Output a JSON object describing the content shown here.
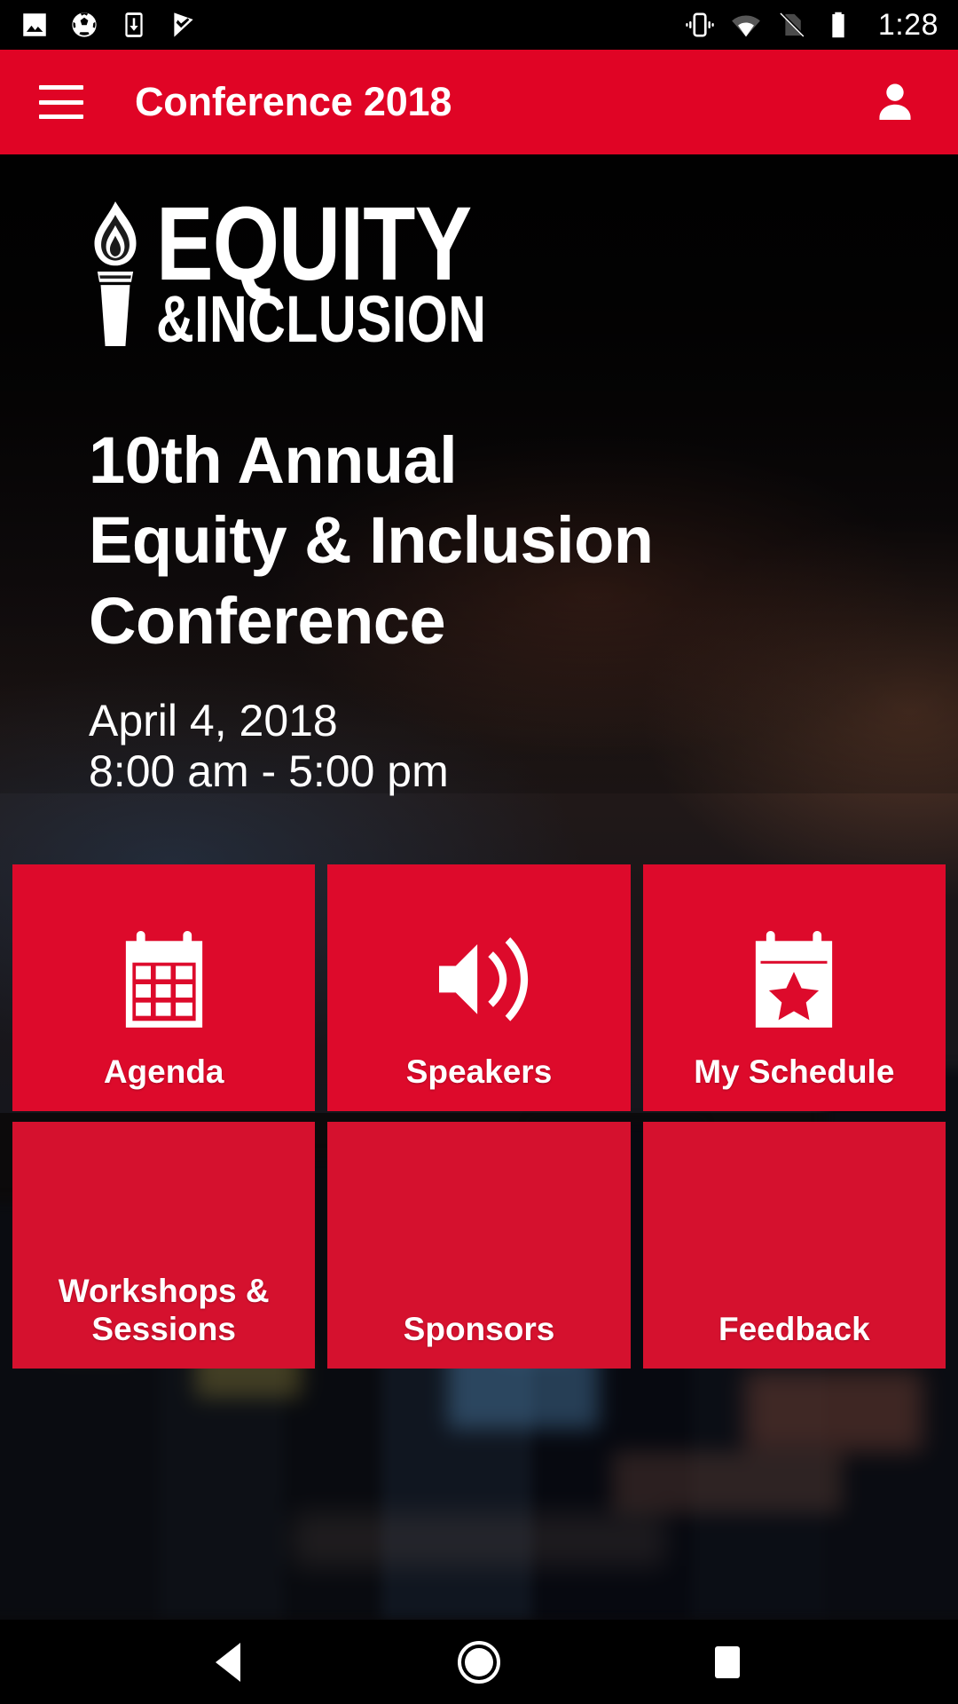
{
  "status_bar": {
    "time": "1:28",
    "left_icons": [
      {
        "name": "photo-icon",
        "label": "Photos"
      },
      {
        "name": "soccer-ball-icon",
        "label": "Soccer"
      },
      {
        "name": "download-to-phone-icon",
        "label": "Download"
      },
      {
        "name": "checkmark-flag-icon",
        "label": "Task complete"
      }
    ],
    "right_icons": [
      {
        "name": "vibrate-icon",
        "label": "Vibrate mode"
      },
      {
        "name": "wifi-icon",
        "label": "Wi-Fi connected"
      },
      {
        "name": "no-sim-icon",
        "label": "No SIM card"
      },
      {
        "name": "battery-full-icon",
        "label": "Battery full"
      }
    ]
  },
  "app_bar": {
    "menu_label": "Menu",
    "title": "Conference 2018",
    "account_label": "Account"
  },
  "hero": {
    "logo": {
      "line1": "EQUITY",
      "line2": "&INCLUSION",
      "icon": "torch-flame-icon"
    },
    "headline_lines": [
      "10th Annual",
      "Equity & Inclusion",
      "Conference"
    ],
    "date": "April 4, 2018",
    "time_range": "8:00 am - 5:00 pm"
  },
  "tiles": [
    {
      "label": "Agenda",
      "icon": "calendar-icon"
    },
    {
      "label": "Speakers",
      "icon": "speaker-volume-icon"
    },
    {
      "label": "My Schedule",
      "icon": "calendar-star-icon"
    },
    {
      "label": "Workshops & Sessions",
      "icon": "workshops-icon"
    },
    {
      "label": "Sponsors",
      "icon": "sponsors-icon"
    },
    {
      "label": "Feedback",
      "icon": "feedback-icon"
    }
  ],
  "nav_bar": {
    "back_label": "Back",
    "home_label": "Home",
    "recents_label": "Recent apps"
  },
  "colors": {
    "brand_red": "#E00425",
    "tile_red": "#DD0A2B",
    "status_bar": "#000000",
    "text_on_dark": "#FFFFFF"
  }
}
